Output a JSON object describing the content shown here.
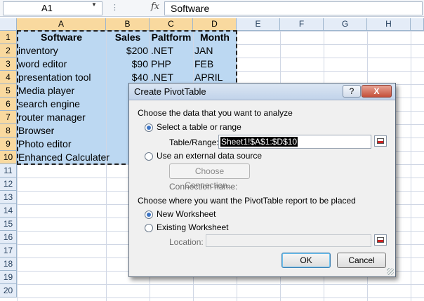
{
  "formula_bar": {
    "name_box": "A1",
    "fx_label": "fx",
    "formula_value": "Software"
  },
  "columns": [
    "A",
    "B",
    "C",
    "D",
    "E",
    "F",
    "G",
    "H"
  ],
  "rows": [
    "1",
    "2",
    "3",
    "4",
    "5",
    "6",
    "7",
    "8",
    "9",
    "10",
    "11",
    "12",
    "13",
    "14",
    "15",
    "16",
    "17",
    "18",
    "19",
    "20"
  ],
  "table": {
    "headers": [
      "Software",
      "Sales",
      "Paltform",
      "Month"
    ],
    "rows": [
      [
        "inventory",
        "$200",
        ".NET",
        "JAN"
      ],
      [
        "word editor",
        "$90",
        "PHP",
        "FEB"
      ],
      [
        "presentation tool",
        "$40",
        ".NET",
        "APRIL"
      ],
      [
        "Media player",
        "",
        "",
        ""
      ],
      [
        "search engine",
        "",
        "",
        ""
      ],
      [
        "router manager",
        "",
        "",
        ""
      ],
      [
        "Browser",
        "",
        "",
        ""
      ],
      [
        "Photo editor",
        "",
        "",
        ""
      ],
      [
        "Enhanced Calculater",
        "",
        "",
        ""
      ]
    ]
  },
  "dialog": {
    "title": "Create PivotTable",
    "help_label": "?",
    "close_label": "X",
    "section1": "Choose the data that you want to analyze",
    "opt_select_table": "Select a table or range",
    "table_range_label": "Table/Range:",
    "table_range_value": "Sheet1!$A$1:$D$10",
    "opt_external": "Use an external data source",
    "choose_connection": "Choose Connection...",
    "connection_name_label": "Connection name:",
    "section2": "Choose where you want the PivotTable report to be placed",
    "opt_new_ws": "New Worksheet",
    "opt_existing_ws": "Existing Worksheet",
    "location_label": "Location:",
    "location_value": "",
    "ok_label": "OK",
    "cancel_label": "Cancel"
  },
  "colors": {
    "selection": "#bcd8f2",
    "header_highlight": "#f9d99f",
    "dialog_bg": "#f0f0f0"
  }
}
